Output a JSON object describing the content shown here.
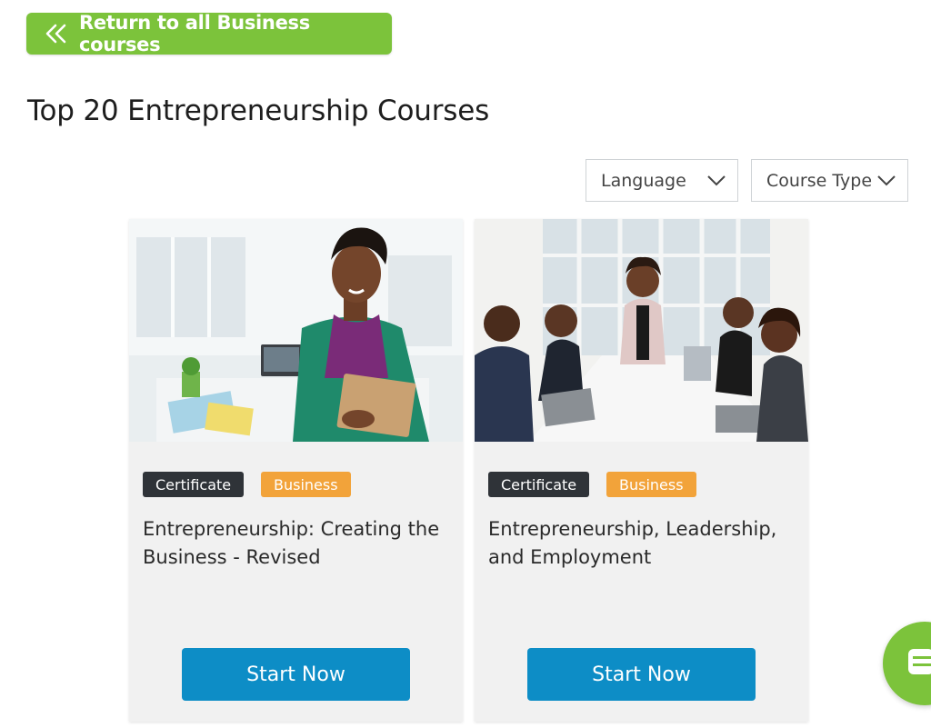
{
  "back_button": {
    "label": "Return to all Business courses",
    "icon": "double-chevron-left-icon"
  },
  "page_title": "Top 20 Entrepreneurship Courses",
  "filters": {
    "language": {
      "label": "Language",
      "icon": "chevron-down-icon"
    },
    "course_type": {
      "label": "Course Type",
      "icon": "chevron-down-icon"
    }
  },
  "courses": [
    {
      "tags": [
        "Certificate",
        "Business"
      ],
      "title": "Entrepreneurship: Creating the Business - Revised",
      "button": "Start Now",
      "image": "woman-holding-notebooks-photo"
    },
    {
      "tags": [
        "Certificate",
        "Business"
      ],
      "title": "Entrepreneurship, Leadership, and Employment",
      "button": "Start Now",
      "image": "team-meeting-photo"
    }
  ],
  "chat": {
    "icon": "chat-icon"
  },
  "colors": {
    "brand_green": "#7cc33b",
    "start_blue": "#0d8dc6",
    "tag_dark": "#2f3338",
    "tag_orange": "#f2a33a",
    "card_bg": "#f1f1f1"
  }
}
